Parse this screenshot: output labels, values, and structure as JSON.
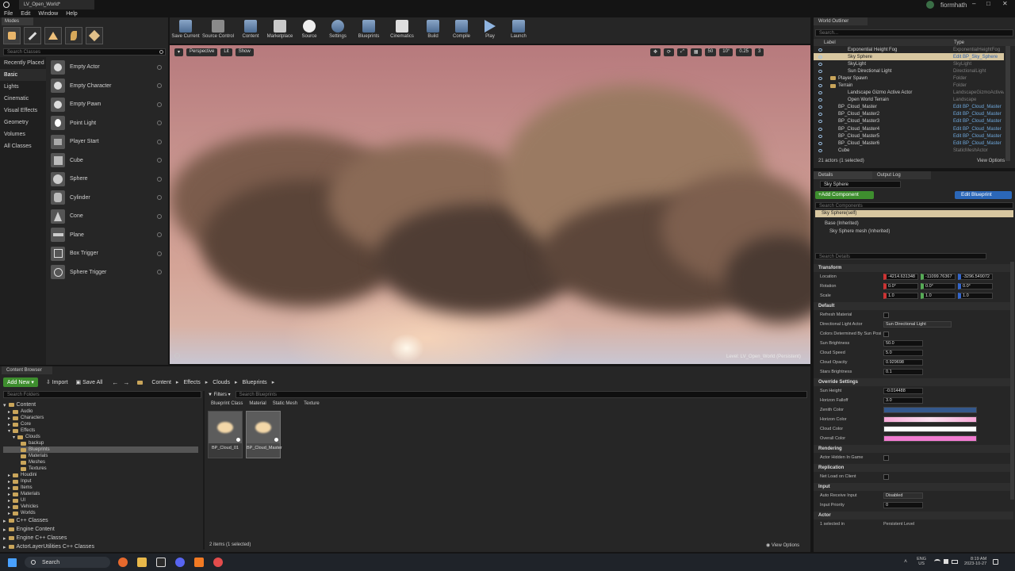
{
  "title_tab": "LV_Open_World*",
  "menu": [
    "File",
    "Edit",
    "Window",
    "Help"
  ],
  "user": "fiormhath",
  "modes": {
    "tab": "Modes",
    "search_placeholder": "Search Classes",
    "categories": [
      "Recently Placed",
      "Basic",
      "Lights",
      "Cinematic",
      "Visual Effects",
      "Geometry",
      "Volumes",
      "All Classes"
    ],
    "items": [
      "Empty Actor",
      "Empty Character",
      "Empty Pawn",
      "Point Light",
      "Player Start",
      "Cube",
      "Sphere",
      "Cylinder",
      "Cone",
      "Plane",
      "Box Trigger",
      "Sphere Trigger"
    ]
  },
  "toolbar": [
    "Save Current",
    "Source Control",
    "Content",
    "Marketplace",
    "Source",
    "Settings",
    "Blueprints",
    "Cinematics",
    "Build",
    "Compile",
    "Play",
    "Launch"
  ],
  "viewport": {
    "perspective": "Perspective",
    "lit": "Lit",
    "show": "Show",
    "grid": "50",
    "angle": "10°",
    "scale": "0.25",
    "cam": "3",
    "level_label": "Level:  LV_Open_World (Persistent)"
  },
  "outliner": {
    "tab": "World Outliner",
    "search_placeholder": "Search...",
    "col_label": "Label",
    "col_type": "Type",
    "rows": [
      {
        "label": "Exponential Height Fog",
        "type": "ExponentialHeightFog"
      },
      {
        "label": "Sky Sphere",
        "type": "Edit BP_Sky_Sphere"
      },
      {
        "label": "SkyLight",
        "type": "SkyLight"
      },
      {
        "label": "Sun Directional Light",
        "type": "DirectionalLight"
      },
      {
        "label": "Player Spawn",
        "type": "Folder"
      },
      {
        "label": "Terrain",
        "type": "Folder"
      },
      {
        "label": "Landscape Gizmo Active Actor",
        "type": "LandscapeGizmoActiveA"
      },
      {
        "label": "Open World Terrain",
        "type": "Landscape"
      },
      {
        "label": "BP_Cloud_Master",
        "type": "Edit BP_Cloud_Master"
      },
      {
        "label": "BP_Cloud_Master2",
        "type": "Edit BP_Cloud_Master"
      },
      {
        "label": "BP_Cloud_Master3",
        "type": "Edit BP_Cloud_Master"
      },
      {
        "label": "BP_Cloud_Master4",
        "type": "Edit BP_Cloud_Master"
      },
      {
        "label": "BP_Cloud_Master5",
        "type": "Edit BP_Cloud_Master"
      },
      {
        "label": "BP_Cloud_Master6",
        "type": "Edit BP_Cloud_Master"
      },
      {
        "label": "Cube",
        "type": "StaticMeshActor"
      }
    ],
    "count": "21 actors (1 selected)",
    "view_options": "View Options"
  },
  "details": {
    "tab": "Details",
    "tab2": "Output Log",
    "name": "Sky Sphere",
    "add_component": "+Add Component",
    "edit_blueprint": "Edit Blueprint",
    "search_components": "Search Components",
    "self": "Sky Sphere(self)",
    "base": "Base (Inherited)",
    "mesh": "Sky Sphere mesh (Inherited)",
    "search_details": "Search Details",
    "transform": "Transform",
    "location_label": "Location",
    "location": [
      "-4214.631348",
      "-11099.76367",
      "-3296.549072"
    ],
    "rotation_label": "Rotation",
    "rotation": [
      "0.0°",
      "0.0°",
      "0.0°"
    ],
    "scale_label": "Scale",
    "scale": [
      "1.0",
      "1.0",
      "1.0"
    ],
    "default": "Default",
    "refresh_material": "Refresh Material",
    "dir_light_label": "Directional Light Actor",
    "dir_light_value": "Sun Directional Light",
    "colors_by_sun": "Colors Determined By Sun Posi",
    "sun_brightness_label": "Sun Brightness",
    "sun_brightness": "50.0",
    "cloud_speed_label": "Cloud Speed",
    "cloud_speed": "5.0",
    "cloud_opacity_label": "Cloud Opacity",
    "cloud_opacity": "0.929698",
    "stars_brightness_label": "Stars Brightness",
    "stars_brightness": "0.1",
    "override": "Override Settings",
    "sun_height_label": "Sun Height",
    "sun_height": "-0.014488",
    "horizon_falloff_label": "Horizon Falloff",
    "horizon_falloff": "3.0",
    "zenith_label": "Zenith Color",
    "horizon_color_label": "Horizon Color",
    "cloud_color_label": "Cloud Color",
    "overall_color_label": "Overall Color",
    "rendering": "Rendering",
    "hidden_in_game": "Actor Hidden In Game",
    "replication": "Replication",
    "net_load": "Net Load on Client",
    "input": "Input",
    "auto_receive_label": "Auto Receive Input",
    "auto_receive": "Disabled",
    "input_priority_label": "Input Priority",
    "input_priority": "0",
    "actor": "Actor",
    "selected_in": "1 selected in",
    "persistent_level": "Persistent Level",
    "colors": {
      "zenith": "#34588c",
      "horizon": "#f4a6d6",
      "cloud": "#ffffff",
      "overall": "#f07bd0"
    }
  },
  "content_browser": {
    "tab": "Content Browser",
    "add_new": "Add New",
    "import": "Import",
    "save_all": "Save All",
    "breadcrumb": [
      "Content",
      "Effects",
      "Clouds",
      "Blueprints"
    ],
    "search_folders": "Search Folders",
    "search_assets": "Search Blueprints",
    "filters": "Filters",
    "filter_chips": [
      "Blueprint Class",
      "Material",
      "Static Mesh",
      "Texture"
    ],
    "tree": [
      {
        "label": "Content",
        "level": 0
      },
      {
        "label": "Audio",
        "level": 1
      },
      {
        "label": "Characters",
        "level": 1
      },
      {
        "label": "Core",
        "level": 1
      },
      {
        "label": "Effects",
        "level": 1
      },
      {
        "label": "Clouds",
        "level": 2
      },
      {
        "label": "backup",
        "level": 3
      },
      {
        "label": "Blueprints",
        "level": 3
      },
      {
        "label": "Materials",
        "level": 3
      },
      {
        "label": "Meshes",
        "level": 3
      },
      {
        "label": "Textures",
        "level": 3
      },
      {
        "label": "Houdini",
        "level": 1
      },
      {
        "label": "Input",
        "level": 1
      },
      {
        "label": "Items",
        "level": 1
      },
      {
        "label": "Materials",
        "level": 1
      },
      {
        "label": "UI",
        "level": 1
      },
      {
        "label": "Vehicles",
        "level": 1
      },
      {
        "label": "Worlds",
        "level": 1
      }
    ],
    "roots": [
      "C++ Classes",
      "Engine Content",
      "Engine C++ Classes",
      "ActorLayerUtilities C++ Classes"
    ],
    "assets": [
      "BP_Cloud_01",
      "BP_Cloud_Master"
    ],
    "status": "2 items (1 selected)",
    "view_options": "View Options"
  },
  "taskbar": {
    "search": "Search",
    "lang": "ENG",
    "region": "US",
    "time": "8:19 AM",
    "date": "2023-10-27"
  }
}
